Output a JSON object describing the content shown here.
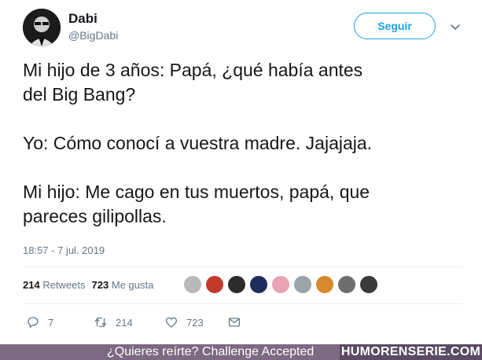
{
  "user": {
    "name": "Dabi",
    "handle": "@BigDabi"
  },
  "follow_label": "Seguir",
  "tweet": {
    "paragraphs": [
      "Mi hijo de 3 años: Papá, ¿qué había antes\ndel Big Bang?",
      "Yo: Cómo conocí a vuestra madre. Jajajaja.",
      "Mi hijo: Me cago en tus muertos, papá, que\npareces gilipollas."
    ],
    "timestamp": "18:57 - 7 jul. 2019"
  },
  "stats": {
    "retweets_count": "214",
    "retweets_label": "Retweets",
    "likes_count": "723",
    "likes_label": "Me gusta"
  },
  "likers": [
    {
      "color": "#b8b8b8"
    },
    {
      "color": "#c0392b"
    },
    {
      "color": "#2c2c2c"
    },
    {
      "color": "#1f2d5a"
    },
    {
      "color": "#e9a3b4"
    },
    {
      "color": "#9aa3a8"
    },
    {
      "color": "#d68a2c"
    },
    {
      "color": "#6d6d6d"
    },
    {
      "color": "#3a3a3a"
    }
  ],
  "actions": {
    "replies": "7",
    "retweets": "214",
    "likes": "723"
  },
  "banner": {
    "text": "¿Quieres reírte? Challenge Accepted",
    "brand": "HUMORENSERIE.COM"
  },
  "colors": {
    "accent": "#1da1f2",
    "muted": "#657786",
    "banner_bg": "#7c6a83",
    "banner_brand_bg": "#5b4b63"
  }
}
